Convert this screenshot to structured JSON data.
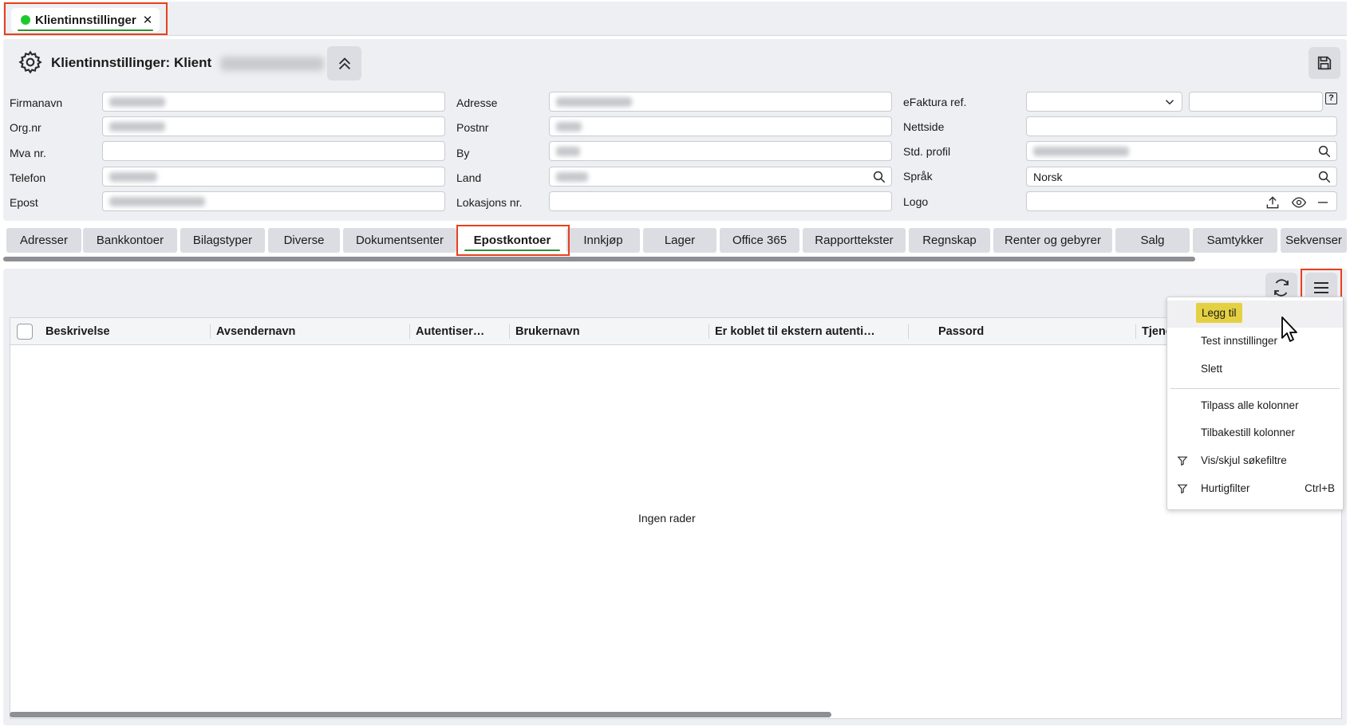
{
  "document_tab": {
    "label": "Klientinnstillinger",
    "close": "✕"
  },
  "header": {
    "title": "Klientinnstillinger: Klient",
    "collapse_icon": "chevron-double-up-icon",
    "save_icon": "save-icon"
  },
  "form": {
    "col1": [
      {
        "label": "Firmanavn"
      },
      {
        "label": "Org.nr"
      },
      {
        "label": "Mva nr."
      },
      {
        "label": "Telefon"
      },
      {
        "label": "Epost"
      }
    ],
    "col2": [
      {
        "label": "Adresse"
      },
      {
        "label": "Postnr"
      },
      {
        "label": "By"
      },
      {
        "label": "Land"
      },
      {
        "label": "Lokasjons nr."
      }
    ],
    "col3": [
      {
        "label": "eFaktura ref."
      },
      {
        "label": "Nettside"
      },
      {
        "label": "Std. profil"
      },
      {
        "label": "Språk",
        "value": "Norsk"
      },
      {
        "label": "Logo"
      }
    ],
    "help": "?"
  },
  "settings_tabs": [
    "Adresser",
    "Bankkontoer",
    "Bilagstyper",
    "Diverse",
    "Dokumentsenter",
    "Epostkontoer",
    "Innkjøp",
    "Lager",
    "Office 365",
    "Rapporttekster",
    "Regnskap",
    "Renter og gebyrer",
    "Salg",
    "Samtykker",
    "Sekvenser"
  ],
  "active_tab": "Epostkontoer",
  "grid": {
    "columns": [
      "Beskrivelse",
      "Avsendernavn",
      "Autentiser…",
      "Brukernavn",
      "Er koblet til ekstern autenti…",
      "Passord",
      "Tjene"
    ],
    "empty_text": "Ingen rader"
  },
  "context_menu": {
    "items": [
      {
        "label": "Legg til",
        "highlighted": true
      },
      {
        "label": "Test innstillinger"
      },
      {
        "label": "Slett"
      },
      {
        "label": "Tilpass alle kolonner"
      },
      {
        "label": "Tilbakestill kolonner"
      },
      {
        "label": "Vis/skjul søkefiltre",
        "icon": "filter-icon"
      },
      {
        "label": "Hurtigfilter",
        "icon": "filter-icon",
        "shortcut": "Ctrl+B"
      }
    ]
  },
  "colors": {
    "accent_green": "#1cc92d",
    "highlight_red": "#e8401c",
    "menu_highlight": "#e4d142"
  }
}
